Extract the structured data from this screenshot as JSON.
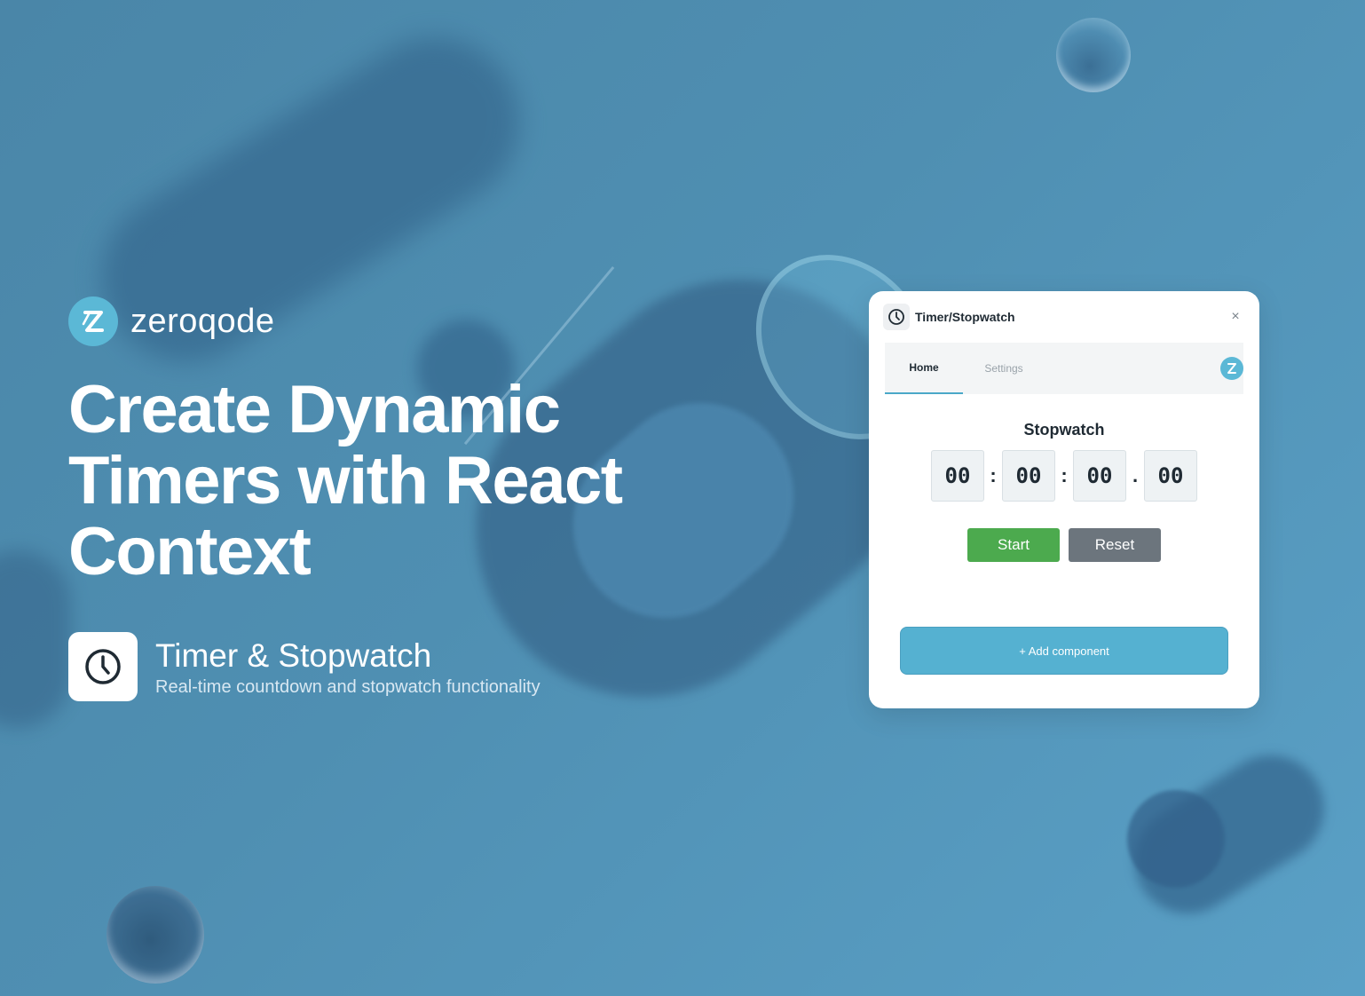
{
  "brand": {
    "name": "zeroqode",
    "logo_icon": "zeroqode-z-icon",
    "accent": "#5bb8d6"
  },
  "hero": {
    "headline": "Create Dynamic Timers with React Context"
  },
  "feature": {
    "icon": "clock-icon",
    "title": "Timer & Stopwatch",
    "subtitle": "Real-time countdown and stopwatch functionality"
  },
  "widget": {
    "title": "Timer/Stopwatch",
    "header_icon": "clock-icon",
    "close_label": "×",
    "tabs": [
      {
        "label": "Home",
        "active": true
      },
      {
        "label": "Settings",
        "active": false
      }
    ],
    "stopwatch": {
      "title": "Stopwatch",
      "hours": "00",
      "minutes": "00",
      "seconds": "00",
      "centiseconds": "00",
      "sep1": ":",
      "sep2": ":",
      "sep3": "."
    },
    "start_label": "Start",
    "reset_label": "Reset",
    "add_component_label": "+ Add component",
    "colors": {
      "start": "#4caa4e",
      "reset": "#6c757d",
      "add": "#55b1d1"
    }
  }
}
